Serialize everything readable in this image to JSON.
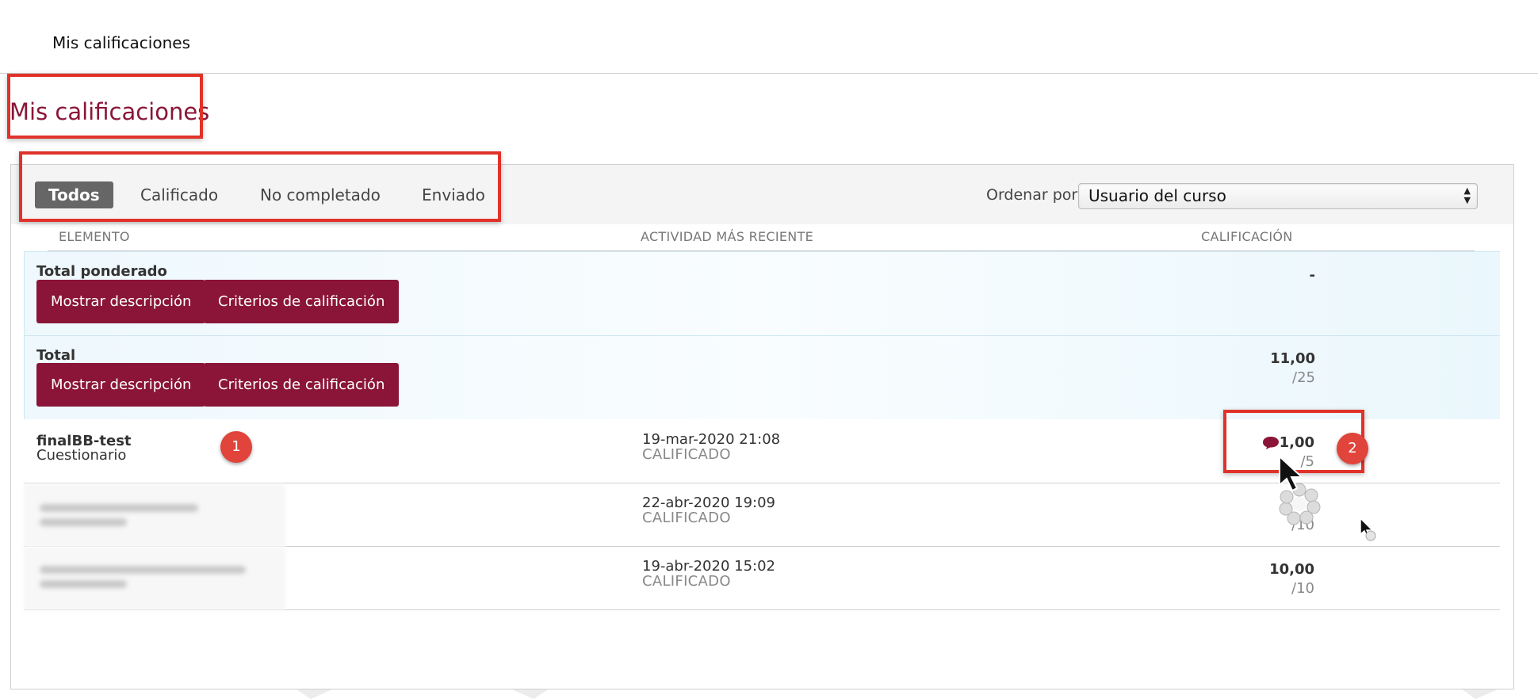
{
  "header": {
    "title": "Mis calificaciones"
  },
  "page": {
    "title": "Mis calificaciones"
  },
  "filters": {
    "tabs": [
      {
        "label": "Todos",
        "active": true
      },
      {
        "label": "Calificado"
      },
      {
        "label": "No completado"
      },
      {
        "label": "Enviado"
      }
    ],
    "sort_label": "Ordenar por:",
    "sort_value": "Usuario del curso"
  },
  "columns": {
    "item": "ELEMENTO",
    "activity": "ACTIVIDAD MÁS RECIENTE",
    "grade": "CALIFICACIÓN"
  },
  "totals": [
    {
      "name": "Total ponderado",
      "buttons": {
        "description": "Mostrar descripción",
        "criteria": "Criterios de calificación"
      },
      "score": "-",
      "max": ""
    },
    {
      "name": "Total",
      "buttons": {
        "description": "Mostrar descripción",
        "criteria": "Criterios de calificación"
      },
      "score": "11,00",
      "max": "/25"
    }
  ],
  "grades": [
    {
      "name": "finalBB-test",
      "type": "Cuestionario",
      "date": "19-mar-2020 21:08",
      "status": "CALIFICADO",
      "score": "1,00",
      "max": "/5",
      "has_comment": true
    },
    {
      "name": "",
      "type": "",
      "date": "22-abr-2020 19:09",
      "status": "CALIFICADO",
      "score": "",
      "max": "/10",
      "has_comment": false
    },
    {
      "name": "",
      "type": "",
      "date": "19-abr-2020 15:02",
      "status": "CALIFICADO",
      "score": "10,00",
      "max": "/10",
      "has_comment": false
    }
  ],
  "annotations": {
    "marker1": "1",
    "marker2": "2"
  },
  "colors": {
    "accent": "#8a1538",
    "annotation": "#e0322a"
  }
}
